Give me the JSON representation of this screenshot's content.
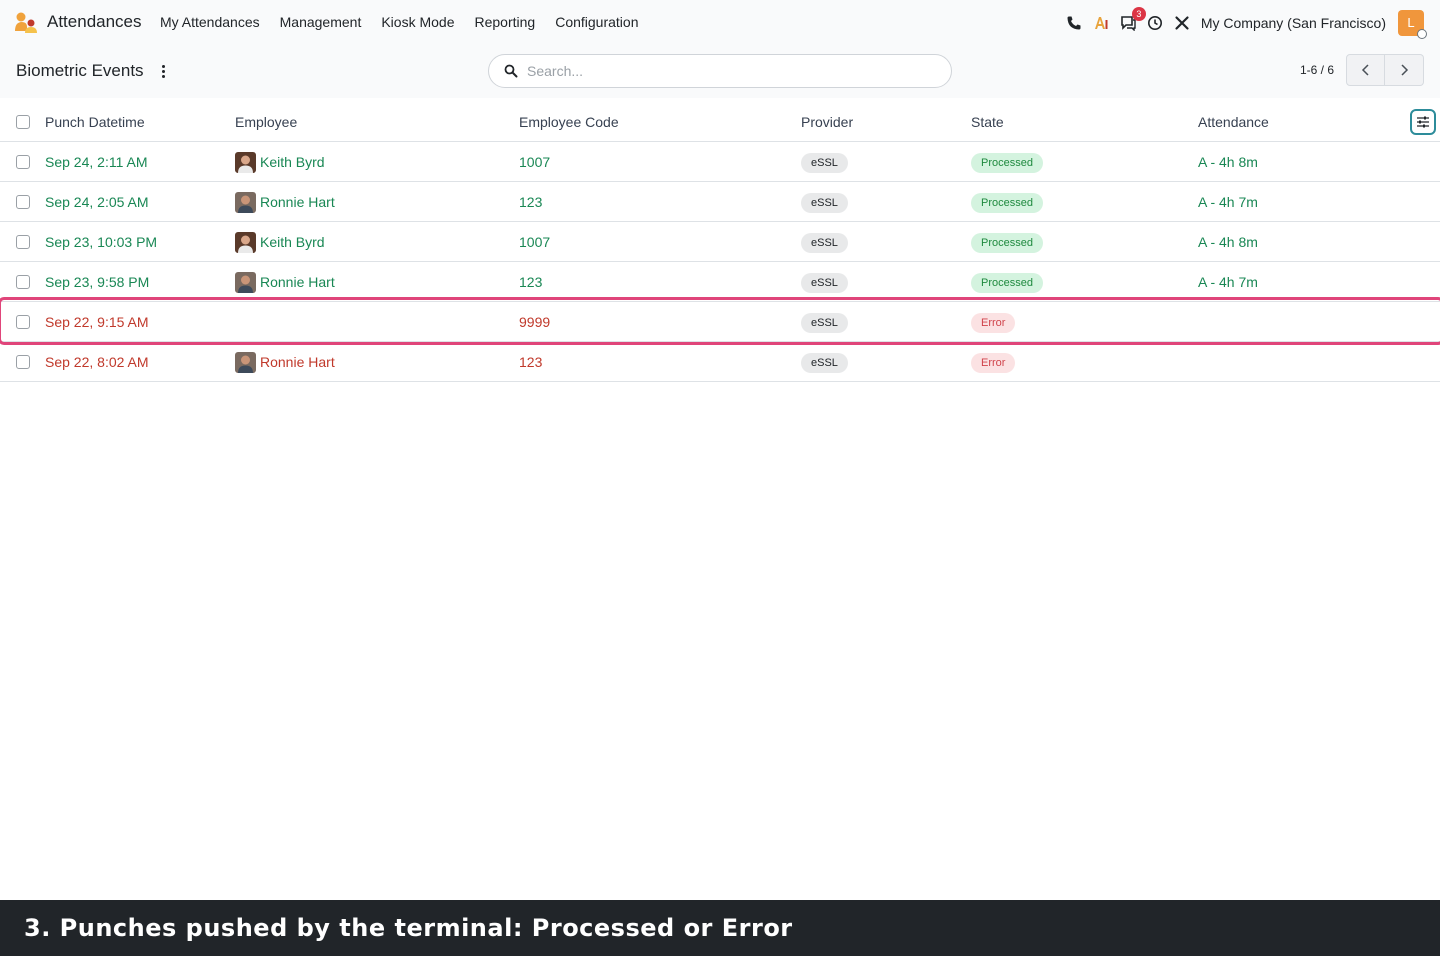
{
  "navbar": {
    "app_name": "Attendances",
    "menu": [
      {
        "label": "My Attendances"
      },
      {
        "label": "Management"
      },
      {
        "label": "Kiosk Mode"
      },
      {
        "label": "Reporting"
      },
      {
        "label": "Configuration"
      }
    ],
    "tray": {
      "icons": [
        "phone-icon",
        "ai-icon",
        "messages-icon",
        "activity-clock-icon",
        "debug-tools-icon"
      ],
      "messages_count": "3",
      "company": "My Company (San Francisco)",
      "user_initial": "L"
    }
  },
  "control_panel": {
    "title": "Biometric Events",
    "search_placeholder": "Search...",
    "pager_value": "1-6 / 6"
  },
  "table": {
    "columns": [
      "Punch Datetime",
      "Employee",
      "Employee Code",
      "Provider",
      "State",
      "Attendance"
    ],
    "rows": [
      {
        "punch": "Sep 24, 2:11 AM",
        "employee": "Keith Byrd",
        "code": "1007",
        "provider": "eSSL",
        "state": "Processed",
        "attendance": "A - 4h 8m"
      },
      {
        "punch": "Sep 24, 2:05 AM",
        "employee": "Ronnie Hart",
        "code": "123",
        "provider": "eSSL",
        "state": "Processed",
        "attendance": "A - 4h 7m"
      },
      {
        "punch": "Sep 23, 10:03 PM",
        "employee": "Keith Byrd",
        "code": "1007",
        "provider": "eSSL",
        "state": "Processed",
        "attendance": "A - 4h 8m"
      },
      {
        "punch": "Sep 23, 9:58 PM",
        "employee": "Ronnie Hart",
        "code": "123",
        "provider": "eSSL",
        "state": "Processed",
        "attendance": "A - 4h 7m"
      },
      {
        "punch": "Sep 22, 9:15 AM",
        "employee": "",
        "code": "9999",
        "provider": "eSSL",
        "state": "Error",
        "attendance": ""
      },
      {
        "punch": "Sep 22, 8:02 AM",
        "employee": "Ronnie Hart",
        "code": "123",
        "provider": "eSSL",
        "state": "Error",
        "attendance": ""
      }
    ]
  },
  "colors": {
    "processed_text": "#198754",
    "error_text": "#c0392b",
    "highlight": "#e0457a"
  },
  "caption": "3. Punches pushed by the terminal: Processed or Error"
}
